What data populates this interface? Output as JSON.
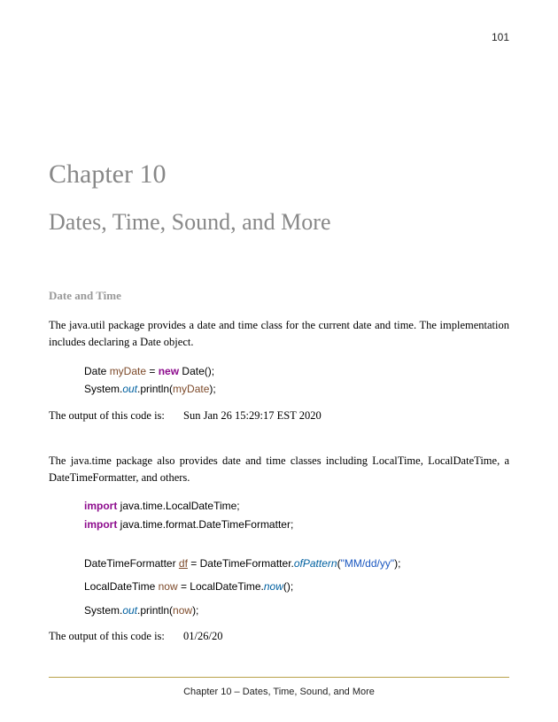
{
  "page_number": "101",
  "chapter_heading": "Chapter 10",
  "chapter_title": "Dates, Time, Sound, and More",
  "section_heading": "Date and Time",
  "para1": "The java.util package provides a date and time class for the current date and time. The implementation includes declaring a Date object.",
  "code1": {
    "l1a": "Date ",
    "l1b": "myDate",
    "l1c": " = ",
    "l1d": "new",
    "l1e": " Date();",
    "l2a": "System.",
    "l2b": "out",
    "l2c": ".println(",
    "l2d": "myDate",
    "l2e": ");"
  },
  "output1_label": "The output of this code is:",
  "output1_value": "Sun Jan 26 15:29:17 EST 2020",
  "para2": "The java.time package also provides date and time classes including LocalTime, LocalDateTime, a DateTimeFormatter, and others.",
  "code2": {
    "l1a": "import",
    "l1b": " java.time.LocalDateTime;",
    "l2a": "import",
    "l2b": " java.time.format.DateTimeFormatter;"
  },
  "code3": {
    "l1a": "DateTimeFormatter ",
    "l1b": "df",
    "l1c": " = DateTimeFormatter.",
    "l1d": "ofPattern",
    "l1e": "(",
    "l1f": "\"MM/dd/yy\"",
    "l1g": ");",
    "l2a": "LocalDateTime ",
    "l2b": "now",
    "l2c": " = LocalDateTime.",
    "l2d": "now",
    "l2e": "();",
    "l3a": "System.",
    "l3b": "out",
    "l3c": ".println(",
    "l3d": "now",
    "l3e": ");"
  },
  "output2_label": "The output of this code is:",
  "output2_value": "01/26/20",
  "footer": "Chapter 10 – Dates, Time, Sound, and More"
}
